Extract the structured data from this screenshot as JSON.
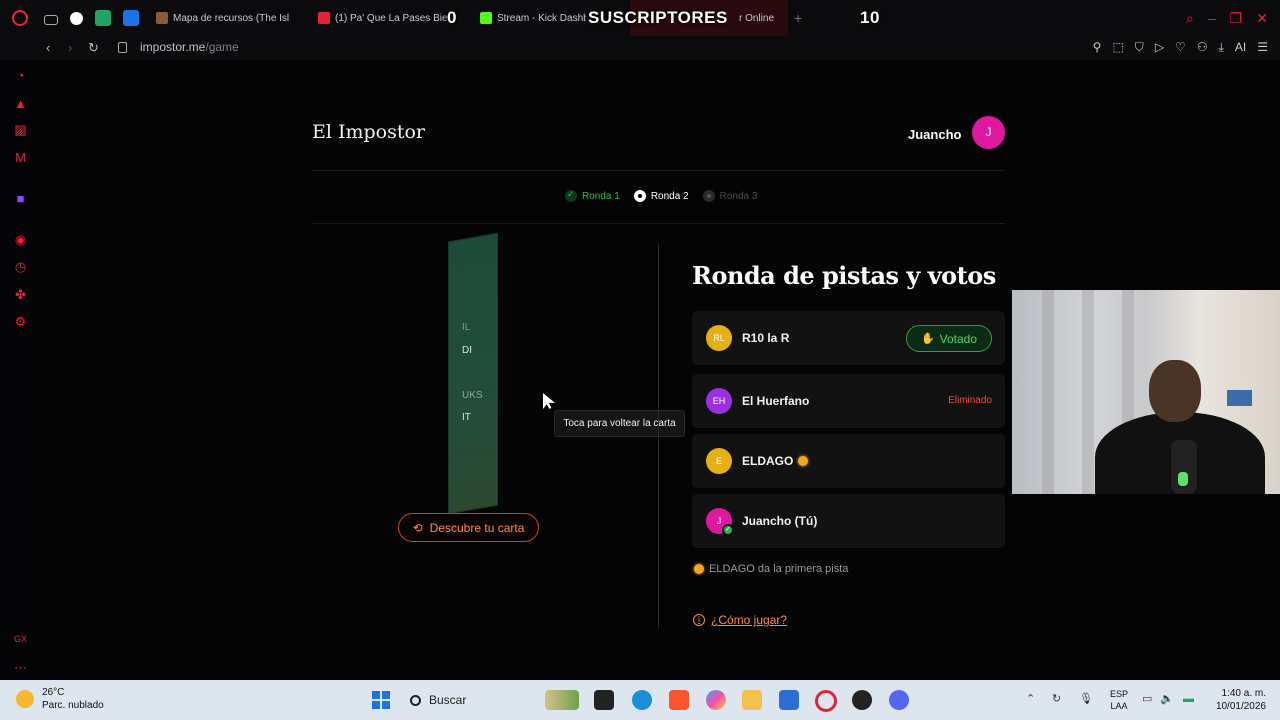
{
  "browser": {
    "tabs": [
      {
        "label": "Mapa de recursos (The Isl",
        "color": "#8a5a3a"
      },
      {
        "label": "(1) Pa' Que La Pases Bie",
        "color": "#e8213a"
      },
      {
        "label": "Stream - Kick Dashb",
        "color": "#53fc18"
      },
      {
        "label": "r Online",
        "color": "#e8213a"
      }
    ],
    "overlay": {
      "left_count": "0",
      "title": "SUSCRIPTORES",
      "right_count": "10"
    },
    "new_tab": "+",
    "url_host": "impostor.me",
    "url_path": "/game",
    "ai_label": "AI"
  },
  "page": {
    "brand": "El Impostor",
    "user": {
      "name": "Juancho",
      "initial": "J",
      "color": "#e0179f"
    },
    "rounds": [
      {
        "label": "Ronda 1",
        "state": "done"
      },
      {
        "label": "Ronda 2",
        "state": "active"
      },
      {
        "label": "Ronda 3",
        "state": "next"
      }
    ],
    "card": {
      "marks": [
        "IL",
        "DI",
        "UKS",
        "IT"
      ]
    },
    "tooltip": "Toca para voltear la carta",
    "reveal_button": "Descubre tu carta",
    "section_title": "Ronda de pistas y votos",
    "players": [
      {
        "initials": "RL",
        "name": "R10 la R",
        "color": "#e6b013",
        "status": "Votado"
      },
      {
        "initials": "EH",
        "name": "El Huerfano",
        "color": "#9b30e0",
        "status": "Eliminado"
      },
      {
        "initials": "E",
        "name": "ELDAGO",
        "color": "#e6b013",
        "status": ""
      },
      {
        "initials": "J",
        "name": "Juancho (Tú)",
        "color": "#e0179f",
        "status": ""
      }
    ],
    "first_hint": "ELDAGO da la primera pista",
    "how_to_play": "¿Cómo jugar?"
  },
  "taskbar": {
    "temperature": "26°C",
    "weather": "Parc. nublado",
    "search": "Buscar",
    "lang_1": "ESP",
    "lang_2": "LAA",
    "time": "1:40 a. m.",
    "date": "10/01/2026"
  }
}
